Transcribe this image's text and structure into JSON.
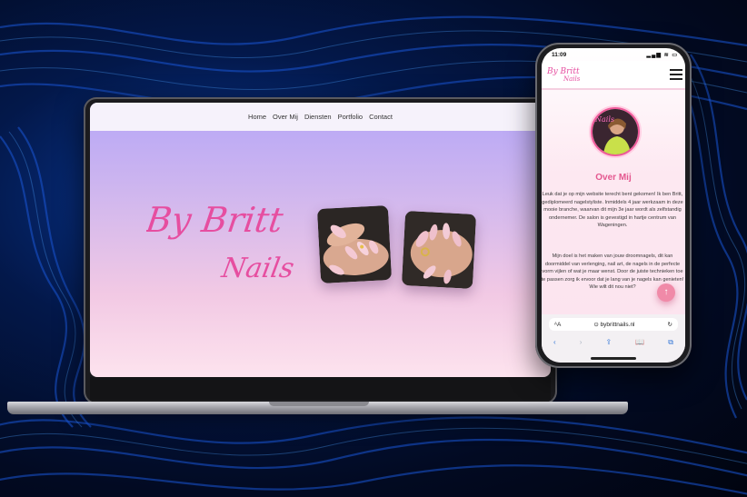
{
  "laptop": {
    "nav": [
      "Home",
      "Over Mij",
      "Diensten",
      "Portfolio",
      "Contact"
    ],
    "logo_line1": "By Britt",
    "logo_line2": "Nails"
  },
  "phone": {
    "status_time": "11:09",
    "status_icons": "▂▄▆ ≋ ▭",
    "logo_line1": "By Britt",
    "logo_line2": "Nails",
    "avatar_sign": "Nails",
    "section_title": "Over Mij",
    "paragraph_1": "Leuk dat je op mijn website terecht bent gekomen! Ik ben Britt, gediplomeerd nagelstyliste. Inmiddels 4 jaar werkzaam in deze mooie branche, waarvan dit mijn 3e jaar wordt als zelfstandig ondernemer. De salon is gevestigd in hartje centrum van Wageningen.",
    "paragraph_2": "Mijn doel is het maken van jouw droomnagels, dit kan doormiddel van verlenging, nail art, de nagels in de perfecte vorm vijlen of wat je maar wenst. Door de juiste technieken toe te passen zorg ik ervoor dat je lang van je nagels kan genieten! Wie wilt dit nou niet?",
    "scroll_top_icon": "arrow-up-icon",
    "url": "⊙ bybrittnails.nl",
    "url_left": "ᴬA",
    "reload": "↻",
    "toolbar": [
      "‹",
      "›",
      "⇪",
      "📖",
      "⧉"
    ]
  },
  "colors": {
    "accent_pink": "#e4578f",
    "hero_top": "#b5a6f7",
    "hero_bottom": "#fde3ee",
    "background": "#03184a"
  }
}
